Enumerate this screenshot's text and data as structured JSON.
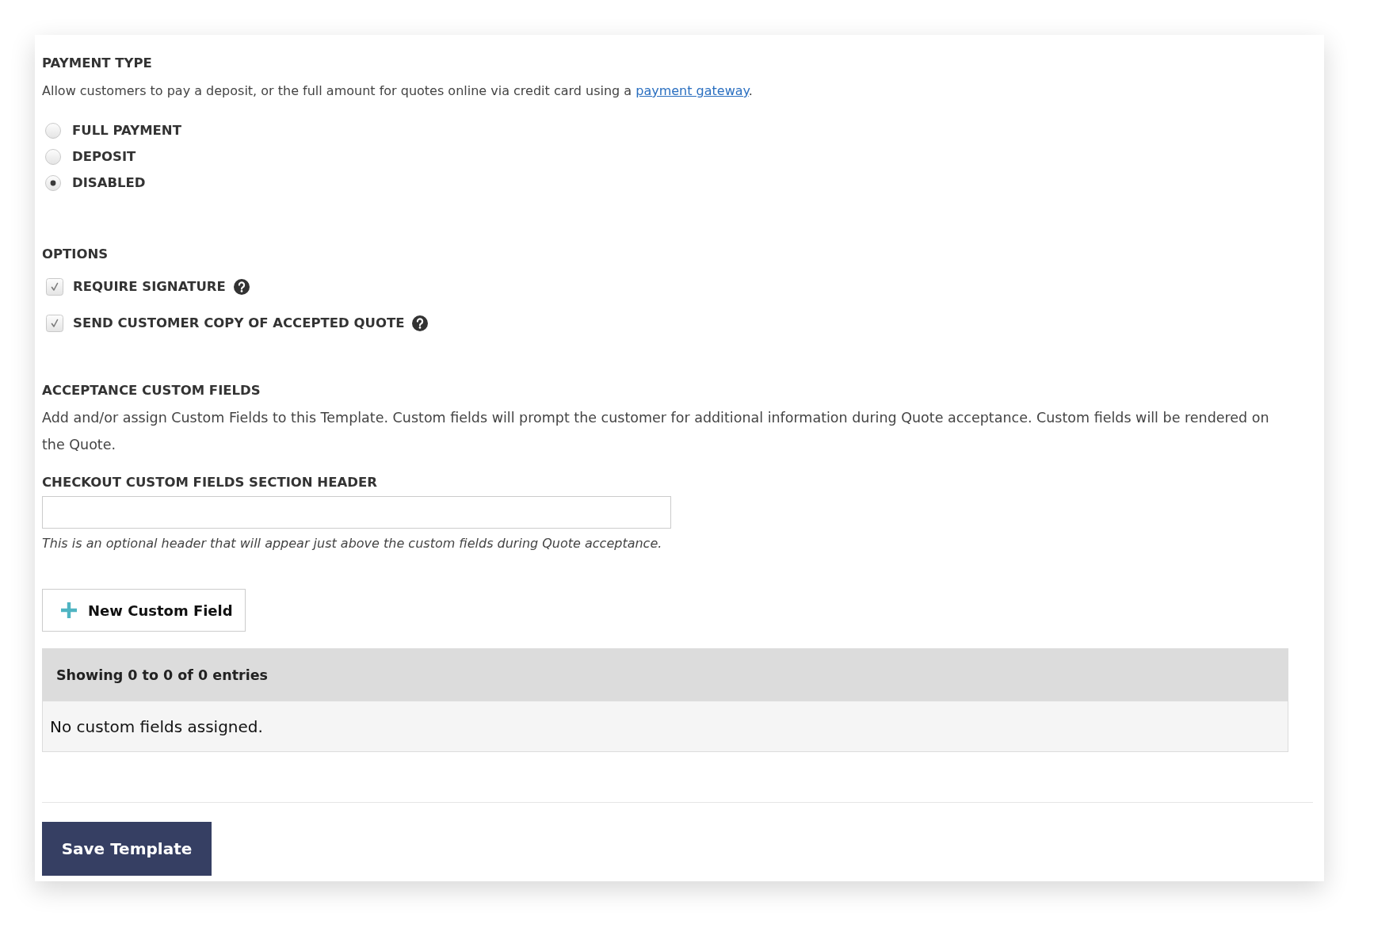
{
  "payment_type": {
    "heading": "PAYMENT TYPE",
    "description": {
      "before": "Allow customers to pay a deposit, or the full amount for quotes online via credit card using a ",
      "link": "payment gateway",
      "after": "."
    },
    "choices": [
      {
        "label": "FULL PAYMENT",
        "selected": false
      },
      {
        "label": "DEPOSIT",
        "selected": false
      },
      {
        "label": "DISABLED",
        "selected": true
      }
    ]
  },
  "options": {
    "heading": "OPTIONS",
    "items": [
      {
        "label": "REQUIRE SIGNATURE",
        "checked": true
      },
      {
        "label": "SEND CUSTOMER COPY OF ACCEPTED QUOTE",
        "checked": true
      }
    ]
  },
  "acceptance_custom_fields": {
    "heading": "ACCEPTANCE CUSTOM FIELDS",
    "description": "Add and/or assign Custom Fields to this Template. Custom fields will prompt the customer for additional information during Quote acceptance. Custom fields will be rendered on the Quote."
  },
  "section_header_field": {
    "label": "CHECKOUT CUSTOM FIELDS SECTION HEADER",
    "help": "This is an optional header that will appear just above the custom fields during Quote acceptance."
  },
  "new_custom_field_button": "New Custom Field",
  "table": {
    "info": "Showing 0 to 0 of 0 entries",
    "empty_message": "No custom fields assigned."
  },
  "save_button": "Save Template"
}
